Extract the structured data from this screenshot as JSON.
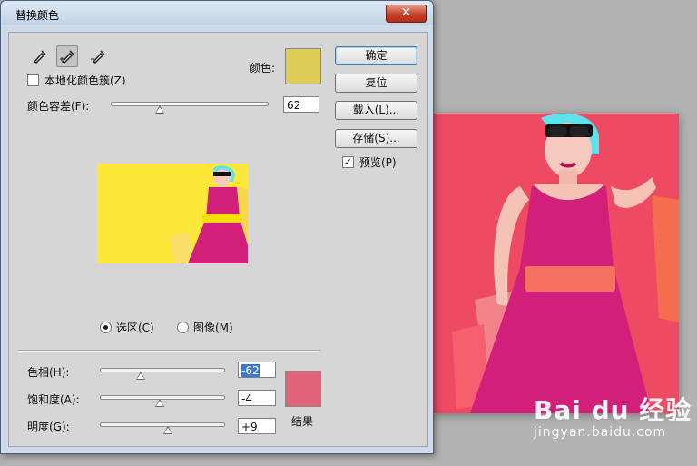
{
  "dialog": {
    "title": "替换颜色",
    "close_glyph": "✕",
    "tools": [
      "eyedropper-icon",
      "eyedropper-plus-icon",
      "eyedropper-minus-icon"
    ],
    "localized_color_clusters": {
      "label": "本地化颜色簇(Z)",
      "checked": false
    },
    "color": {
      "label": "颜色:",
      "swatch": "#dfcd59"
    },
    "fuzziness": {
      "label": "颜色容差(F):",
      "value": "62",
      "level": 0.31
    },
    "view": {
      "options": [
        "选区(C)",
        "图像(M)"
      ],
      "selected": "选区(C)"
    },
    "replacement": {
      "hue": {
        "label": "色相(H):",
        "value": "-62",
        "level": 0.41
      },
      "saturation": {
        "label": "饱和度(A):",
        "value": "-4",
        "level": 0.49
      },
      "lightness": {
        "label": "明度(G):",
        "value": "+9",
        "level": 0.55
      },
      "result_label": "结果",
      "result_swatch": "#e3647a"
    },
    "buttons": {
      "ok": "确定",
      "reset": "复位",
      "load": "载入(L)...",
      "save": "存储(S)..."
    },
    "preview_option": {
      "label": "预览(P)",
      "checked": true
    }
  },
  "watermark": {
    "logo": "Bai du 经验",
    "url": "jingyan.baidu.com"
  },
  "colors": {
    "photo_bg": "#ef4a63",
    "dress": "#d21f7a",
    "belt": "#f5725e",
    "preview_bg": "#fde83a"
  }
}
